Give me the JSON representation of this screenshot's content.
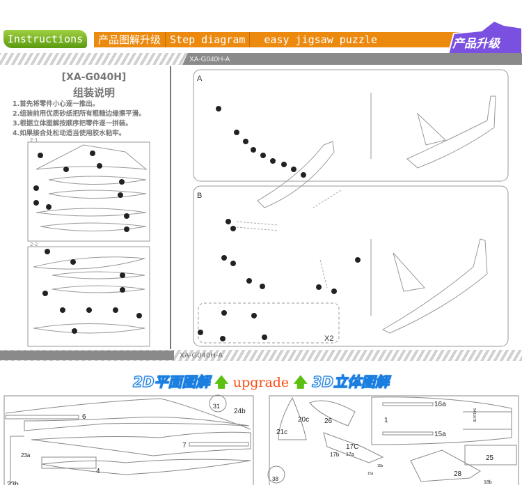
{
  "header": {
    "tab_label": "Instructions",
    "segments": [
      "产品图解升级",
      "Step diagram",
      "easy jigsaw puzzle"
    ],
    "logo_text": "产品升级",
    "colors": {
      "tab": "#6aaa18",
      "bar": "#ec8a10",
      "logo": "#7a50e0"
    }
  },
  "bands": {
    "top_code": "XA-G040H-A",
    "bottom_code": "XA-G040H-A"
  },
  "instructions": {
    "model": "[XA-G040H]",
    "title": "组装说明",
    "steps": [
      "1.首先将零件小心逐一推出。",
      "2.组装前用优质砂纸把所有粗糙边缘擦平滑。",
      "3.根据立体图解按顺序把零件逐一拼装。",
      "4.如果接合处松动适当使用胶水粘牢。"
    ],
    "sheet_labels": [
      "2-1",
      "2-2"
    ]
  },
  "panels": {
    "a_label": "A",
    "b_label": "B",
    "multiplier": "X2"
  },
  "upgrade": {
    "left": "2D平面图解",
    "middle": "upgrade",
    "right": "3D立体图解",
    "arrow_icon": "up-arrow-icon"
  },
  "bottom_left_parts": [
    "6",
    "31",
    "24b",
    "7",
    "23a",
    "4",
    "23b"
  ],
  "bottom_right_parts": [
    "20c",
    "26",
    "16a",
    "1",
    "21c",
    "15a",
    "17C",
    "17b",
    "17a",
    "25",
    "15b",
    "15a",
    "28",
    "38",
    "18b"
  ],
  "stack_numbers": "5431678"
}
